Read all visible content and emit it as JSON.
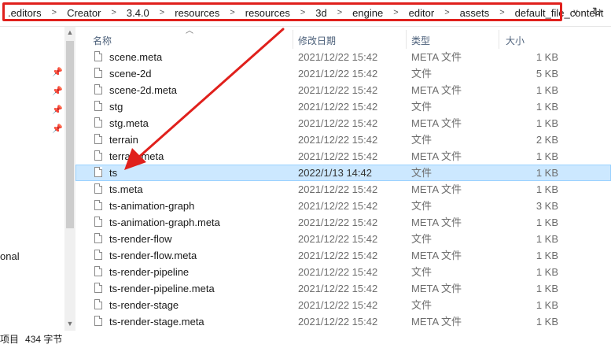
{
  "address_bar": {
    "crumbs": [
      ".editors",
      "Creator",
      "3.4.0",
      "resources",
      "resources",
      "3d",
      "engine",
      "editor",
      "assets",
      "default_file_content"
    ],
    "separator": ">",
    "dropdown_glyph": "∨",
    "refresh_glyph": "↻"
  },
  "nav_pane": {
    "pins": [
      "📌",
      "📌",
      "📌",
      "📌"
    ],
    "partial_label": "onal"
  },
  "columns": {
    "name": "名称",
    "date": "修改日期",
    "type": "类型",
    "size": "大小"
  },
  "files": [
    {
      "name": "scene.meta",
      "date": "2021/12/22 15:42",
      "type": "META 文件",
      "size": "1 KB"
    },
    {
      "name": "scene-2d",
      "date": "2021/12/22 15:42",
      "type": "文件",
      "size": "5 KB"
    },
    {
      "name": "scene-2d.meta",
      "date": "2021/12/22 15:42",
      "type": "META 文件",
      "size": "1 KB"
    },
    {
      "name": "stg",
      "date": "2021/12/22 15:42",
      "type": "文件",
      "size": "1 KB"
    },
    {
      "name": "stg.meta",
      "date": "2021/12/22 15:42",
      "type": "META 文件",
      "size": "1 KB"
    },
    {
      "name": "terrain",
      "date": "2021/12/22 15:42",
      "type": "文件",
      "size": "2 KB"
    },
    {
      "name": "terrain.meta",
      "date": "2021/12/22 15:42",
      "type": "META 文件",
      "size": "1 KB"
    },
    {
      "name": "ts",
      "date": "2022/1/13 14:42",
      "type": "文件",
      "size": "1 KB",
      "selected": true
    },
    {
      "name": "ts.meta",
      "date": "2021/12/22 15:42",
      "type": "META 文件",
      "size": "1 KB"
    },
    {
      "name": "ts-animation-graph",
      "date": "2021/12/22 15:42",
      "type": "文件",
      "size": "3 KB"
    },
    {
      "name": "ts-animation-graph.meta",
      "date": "2021/12/22 15:42",
      "type": "META 文件",
      "size": "1 KB"
    },
    {
      "name": "ts-render-flow",
      "date": "2021/12/22 15:42",
      "type": "文件",
      "size": "1 KB"
    },
    {
      "name": "ts-render-flow.meta",
      "date": "2021/12/22 15:42",
      "type": "META 文件",
      "size": "1 KB"
    },
    {
      "name": "ts-render-pipeline",
      "date": "2021/12/22 15:42",
      "type": "文件",
      "size": "1 KB"
    },
    {
      "name": "ts-render-pipeline.meta",
      "date": "2021/12/22 15:42",
      "type": "META 文件",
      "size": "1 KB"
    },
    {
      "name": "ts-render-stage",
      "date": "2021/12/22 15:42",
      "type": "文件",
      "size": "1 KB"
    },
    {
      "name": "ts-render-stage.meta",
      "date": "2021/12/22 15:42",
      "type": "META 文件",
      "size": "1 KB"
    }
  ],
  "status_bar": {
    "items_label": "项目",
    "size_label": "434 字节"
  },
  "colors": {
    "highlight_box": "#e0201c",
    "arrow": "#e0201c",
    "selected_row": "#cce8ff"
  }
}
